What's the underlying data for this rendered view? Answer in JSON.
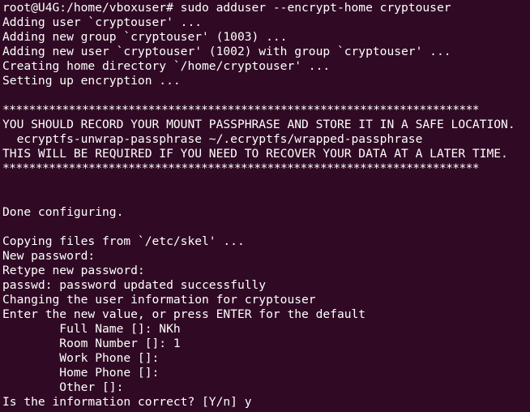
{
  "terminal": {
    "lines": [
      "root@U4G:/home/vboxuser# sudo adduser --encrypt-home cryptouser",
      "Adding user `cryptouser' ...",
      "Adding new group `cryptouser' (1003) ...",
      "Adding new user `cryptouser' (1002) with group `cryptouser' ...",
      "Creating home directory `/home/cryptouser' ...",
      "Setting up encryption ...",
      "",
      "************************************************************************",
      "YOU SHOULD RECORD YOUR MOUNT PASSPHRASE AND STORE IT IN A SAFE LOCATION.",
      "  ecryptfs-unwrap-passphrase ~/.ecryptfs/wrapped-passphrase",
      "THIS WILL BE REQUIRED IF YOU NEED TO RECOVER YOUR DATA AT A LATER TIME.",
      "************************************************************************",
      "",
      "",
      "Done configuring.",
      "",
      "Copying files from `/etc/skel' ...",
      "New password:",
      "Retype new password:",
      "passwd: password updated successfully",
      "Changing the user information for cryptouser",
      "Enter the new value, or press ENTER for the default",
      "        Full Name []: NKh",
      "        Room Number []: 1",
      "        Work Phone []:",
      "        Home Phone []:",
      "        Other []:",
      "Is the information correct? [Y/n] y"
    ]
  }
}
